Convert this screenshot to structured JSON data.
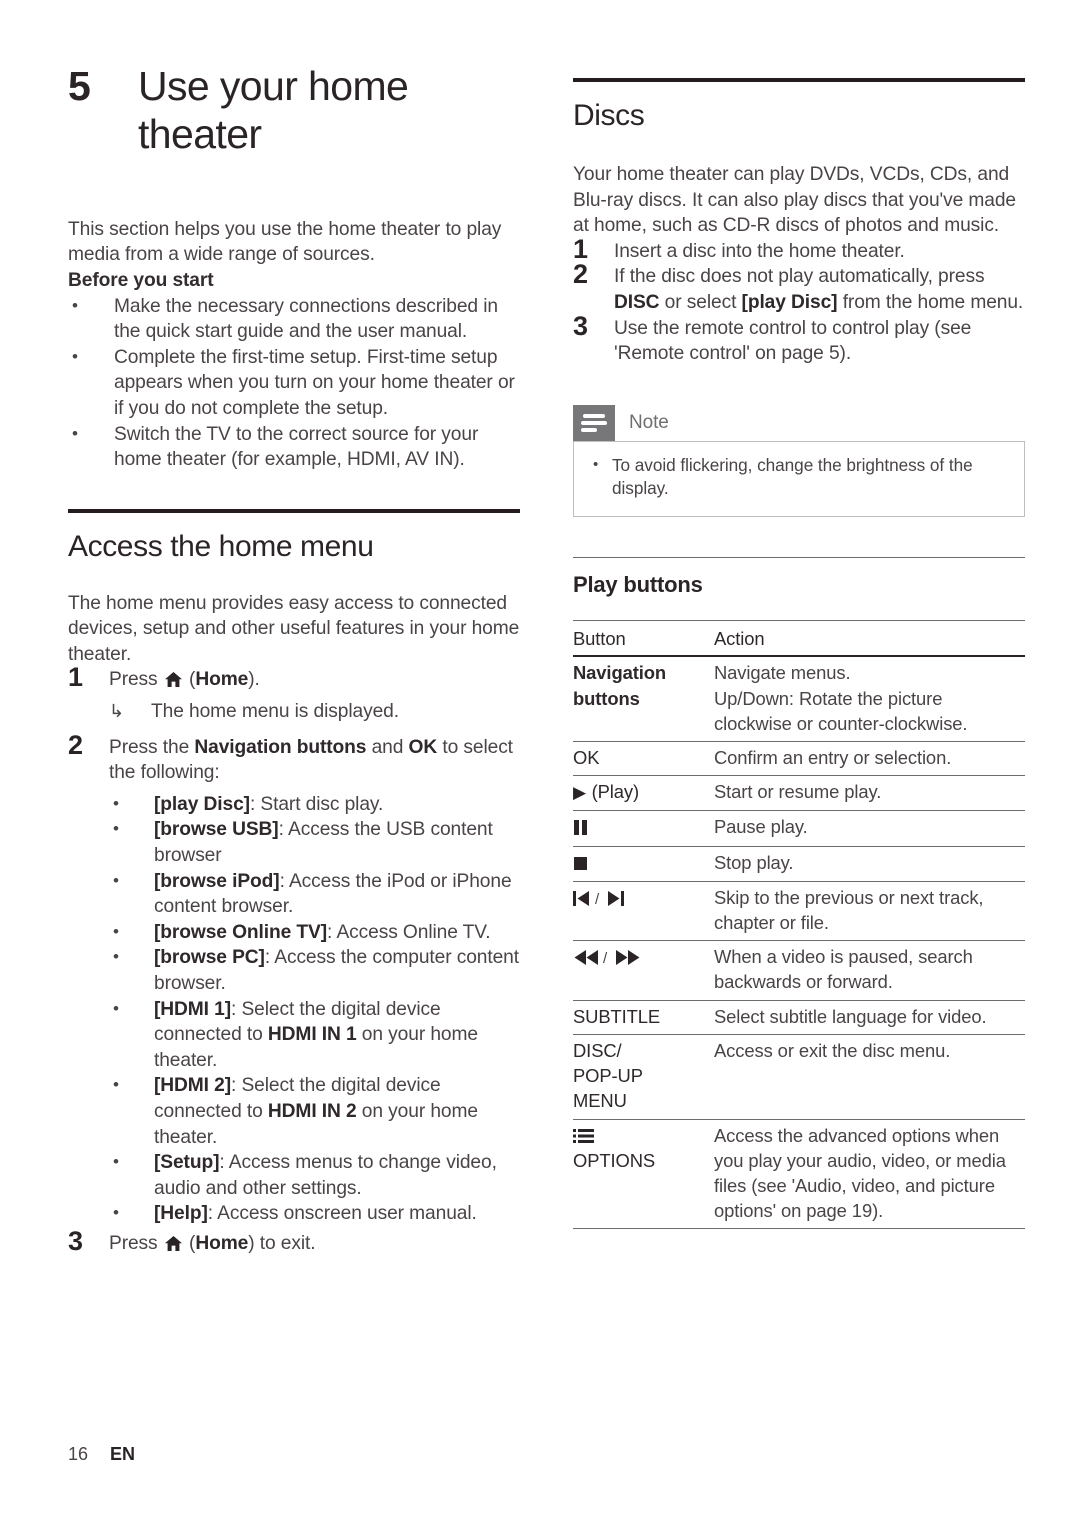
{
  "chapter": {
    "number": "5",
    "title_line1": "Use your home",
    "title_line2": "theater"
  },
  "intro": {
    "paragraph": "This section helps you use the home theater to play media from a wide range of sources.",
    "before_you_start_label": "Before you start",
    "bullets": [
      "Make the necessary connections described in the quick start guide and the user manual.",
      "Complete the first-time setup. First-time setup appears when you turn on your home theater or if you do not complete the setup.",
      "Switch the TV to the correct source for your home theater (for example, HDMI, AV IN)."
    ]
  },
  "home_menu": {
    "heading": "Access the home menu",
    "intro": "The home menu provides easy access to connected devices, setup and other useful features in your home theater.",
    "step1": {
      "number": "1",
      "text_before": "Press",
      "icon": "home-icon",
      "text_after": "(Home).",
      "home_word": "Home",
      "sub_arrow_glyph": "↳",
      "sub_text": "The home menu is displayed."
    },
    "step2": {
      "number": "2",
      "text_before": "Press the",
      "bold1": "Navigation buttons",
      "text_mid": "and",
      "bold2": "OK",
      "text_after": "to select the following:",
      "options": [
        {
          "term": "[play Disc]",
          "desc": ": Start disc play."
        },
        {
          "term": "[browse USB]",
          "desc": ": Access the USB content browser"
        },
        {
          "term": "[browse iPod]",
          "desc": ": Access the iPod or iPhone content browser."
        },
        {
          "term": "[browse Online TV]",
          "desc": ": Access Online TV."
        },
        {
          "term": "[browse PC]",
          "desc": ": Access the computer content browser."
        },
        {
          "term": "[HDMI 1]",
          "desc_pre": ": Select the digital device connected to ",
          "desc_bold": "HDMI IN 1",
          "desc_post": " on your home theater."
        },
        {
          "term": "[HDMI 2]",
          "desc_pre": ": Select the digital device connected to ",
          "desc_bold": "HDMI IN 2",
          "desc_post": " on your home theater."
        },
        {
          "term": "[Setup]",
          "desc": ": Access menus to change video, audio and other settings."
        },
        {
          "term": "[Help]",
          "desc": ": Access onscreen user manual."
        }
      ]
    },
    "step3": {
      "number": "3",
      "text_before": "Press",
      "icon": "home-icon",
      "home_word": "Home",
      "text_after": "(Home) to exit."
    }
  },
  "discs": {
    "heading": "Discs",
    "intro": "Your home theater can play DVDs, VCDs, CDs, and Blu-ray discs. It can also play discs that you've made at home, such as CD-R discs of photos and music.",
    "steps": [
      {
        "number": "1",
        "text": "Insert a disc into the home theater."
      },
      {
        "number": "2",
        "text_pre": "If the disc does not play automatically, press ",
        "bold1": "DISC",
        "text_mid": " or select ",
        "bold2": "[play Disc]",
        "text_post": " from the home menu."
      },
      {
        "number": "3",
        "text": "Use the remote control to control play (see 'Remote control' on page 5)."
      }
    ]
  },
  "note": {
    "label": "Note",
    "icon": "note-lines-icon",
    "items": [
      "To avoid flickering, change the brightness of the display."
    ]
  },
  "play_buttons": {
    "heading": "Play buttons",
    "columns": [
      "Button",
      "Action"
    ],
    "rows": [
      {
        "button": "Navigation buttons",
        "button_style": "bold",
        "action": "Navigate menus.\nUp/Down: Rotate the picture clockwise or counter-clockwise."
      },
      {
        "button": "OK",
        "button_style": "plain",
        "action": "Confirm an entry or selection."
      },
      {
        "button": "▶ (Play)",
        "button_style": "icon",
        "icon_name": "play-icon",
        "action": "Start or resume play."
      },
      {
        "button": "❚❚",
        "button_style": "icon",
        "icon_name": "pause-icon",
        "action": "Pause play."
      },
      {
        "button": "■",
        "button_style": "icon",
        "icon_name": "stop-icon",
        "action": "Stop play."
      },
      {
        "button": "⏮ / ⏭",
        "button_style": "icon",
        "icon_name": "skip-prev-next-icon",
        "action": "Skip to the previous or next track, chapter or file."
      },
      {
        "button": "⏪ / ⏩",
        "button_style": "icon",
        "icon_name": "rewind-forward-icon",
        "action": "When a video is paused, search backwards or forward."
      },
      {
        "button": "SUBTITLE",
        "button_style": "plain",
        "action": "Select subtitle language for video."
      },
      {
        "button": "DISC/ POP-UP MENU",
        "button_style": "plain-multiline",
        "action": "Access or exit the disc menu."
      },
      {
        "button": "OPTIONS",
        "button_style": "icon-label",
        "icon_name": "options-list-icon",
        "action": "Access the advanced options when you play your audio, video, or media files (see 'Audio, video, and picture options' on page 19)."
      }
    ]
  },
  "footer": {
    "page_number": "16",
    "language": "EN"
  }
}
